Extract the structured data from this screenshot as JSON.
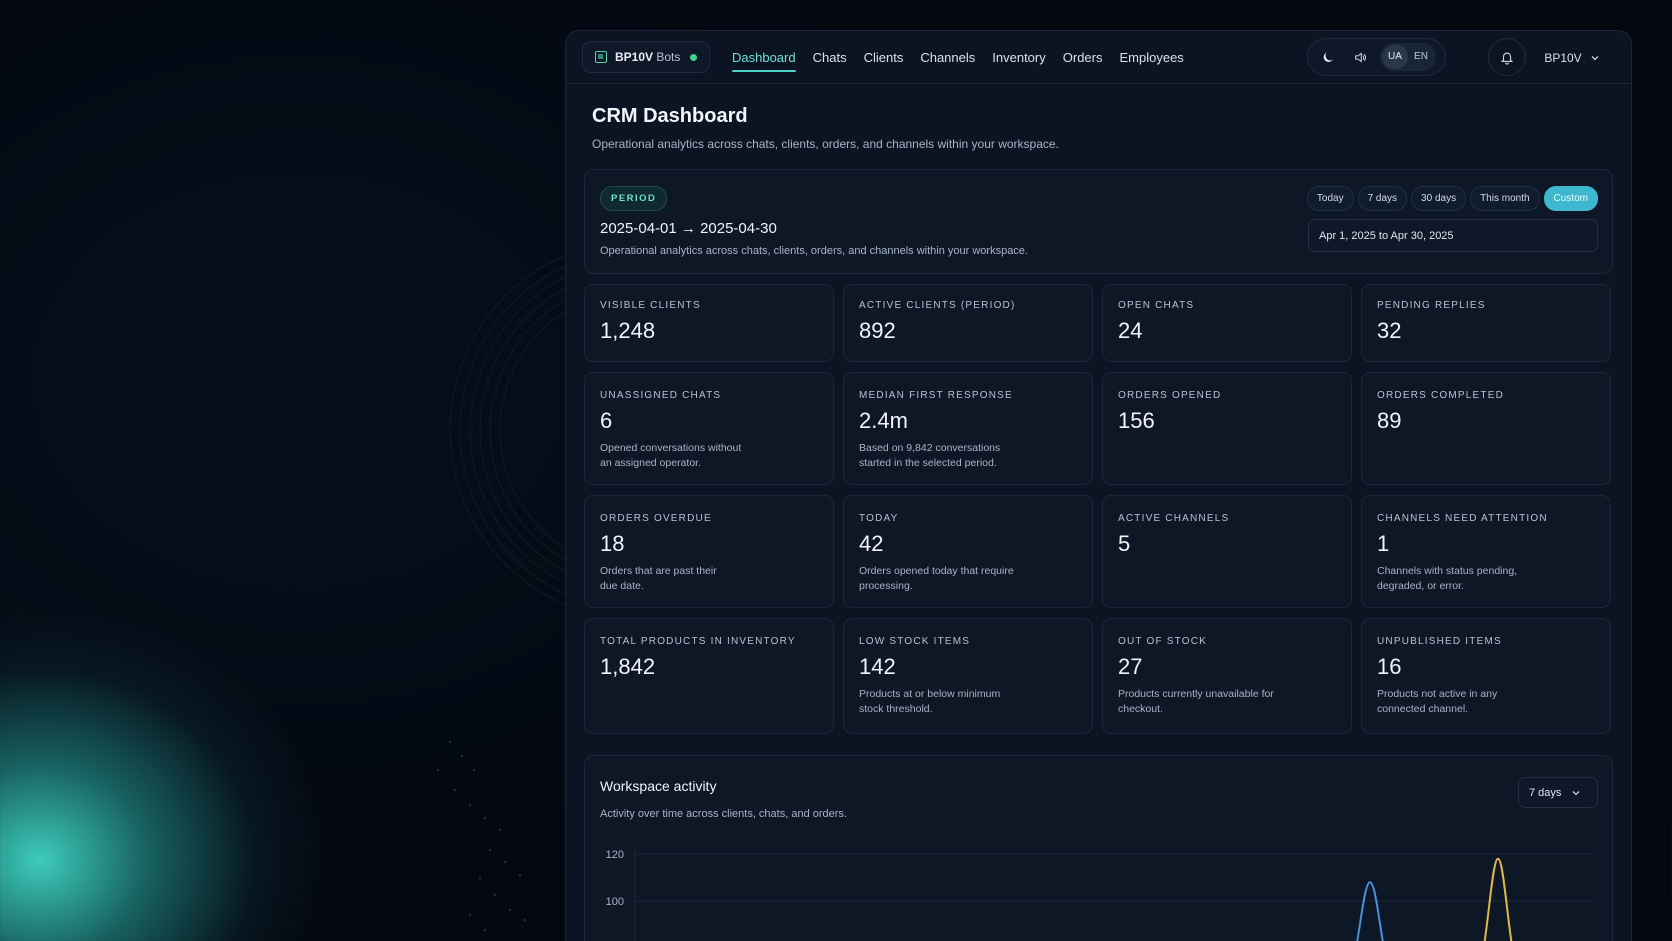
{
  "brand": {
    "name_bold": "BP10V",
    "name_rest": "Bots",
    "status_color": "#3fd48a"
  },
  "nav": {
    "items": [
      {
        "label": "Dashboard",
        "active": true
      },
      {
        "label": "Chats"
      },
      {
        "label": "Clients"
      },
      {
        "label": "Channels"
      },
      {
        "label": "Inventory"
      },
      {
        "label": "Orders"
      },
      {
        "label": "Employees"
      }
    ]
  },
  "controls": {
    "theme_icon": "moon-icon",
    "sound_icon": "speaker-icon",
    "languages": [
      "UA",
      "EN"
    ],
    "active_language": "UA",
    "notification_icon": "bell-icon"
  },
  "user": {
    "name": "BP10V"
  },
  "page": {
    "title": "CRM Dashboard",
    "subtitle": "Operational analytics across chats, clients, orders, and channels within your workspace."
  },
  "period": {
    "badge": "PERIOD",
    "range": "2025-04-01 → 2025-04-30",
    "description": "Operational analytics across chats, clients, orders, and channels within your workspace.",
    "presets": [
      "Today",
      "7 days",
      "30 days",
      "This month",
      "Custom"
    ],
    "active_preset": "Custom",
    "date_input": "Apr 1, 2025 to Apr 30, 2025"
  },
  "metrics": {
    "visible_clients": {
      "label": "VISIBLE CLIENTS",
      "value": "1,248"
    },
    "active_clients": {
      "label": "ACTIVE CLIENTS (PERIOD)",
      "value": "892"
    },
    "open_chats": {
      "label": "OPEN CHATS",
      "value": "24"
    },
    "pending_replies": {
      "label": "PENDING REPLIES",
      "value": "32"
    },
    "unassigned_chats": {
      "label": "UNASSIGNED CHATS",
      "value": "6",
      "note": "Opened conversations without an assigned operator."
    },
    "median_first_response": {
      "label": "MEDIAN FIRST RESPONSE",
      "value": "2.4m",
      "note": "Based on 9,842 conversations started in the selected period."
    },
    "orders_opened": {
      "label": "ORDERS OPENED",
      "value": "156"
    },
    "orders_completed": {
      "label": "ORDERS COMPLETED",
      "value": "89"
    },
    "orders_overdue": {
      "label": "ORDERS OVERDUE",
      "value": "18",
      "note": "Orders that are past their due date."
    },
    "today": {
      "label": "TODAY",
      "value": "42",
      "note": "Orders opened today that require processing."
    },
    "active_channels": {
      "label": "ACTIVE CHANNELS",
      "value": "5"
    },
    "channels_need_attention": {
      "label": "CHANNELS NEED ATTENTION",
      "value": "1",
      "note": "Channels with status pending, degraded, or error."
    },
    "total_products": {
      "label": "TOTAL PRODUCTS IN INVENTORY",
      "value": "1,842"
    },
    "low_stock": {
      "label": "LOW STOCK ITEMS",
      "value": "142",
      "note": "Products at or below minimum stock threshold."
    },
    "out_of_stock": {
      "label": "OUT OF STOCK",
      "value": "27",
      "note": "Products currently unavailable for checkout."
    },
    "unpublished": {
      "label": "UNPUBLISHED ITEMS",
      "value": "16",
      "note": "Products not active in any connected channel."
    }
  },
  "activity": {
    "title": "Workspace activity",
    "subtitle": "Activity over time across clients, chats, and orders.",
    "range": "7 days"
  },
  "chart_data": {
    "type": "line",
    "title": "",
    "ylim": [
      0,
      120
    ],
    "yticks": [
      "120",
      "100"
    ],
    "grid": true,
    "series": [
      {
        "color": "#4a8fe0",
        "peak_value": 108
      },
      {
        "color": "#e0b64a",
        "peak_value": 118
      }
    ]
  }
}
